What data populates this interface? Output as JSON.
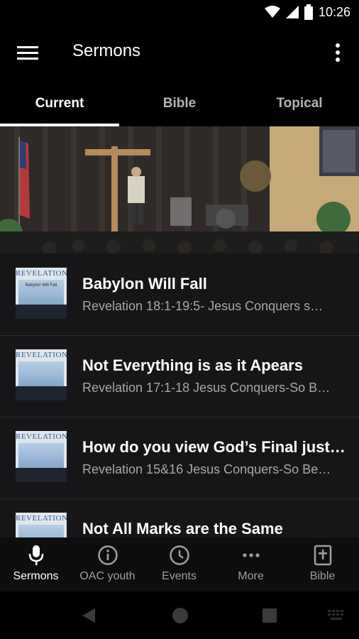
{
  "status": {
    "time": "10:26"
  },
  "app": {
    "title": "Sermons"
  },
  "tabs": [
    {
      "label": "Current",
      "active": true
    },
    {
      "label": "Bible",
      "active": false
    },
    {
      "label": "Topical",
      "active": false
    }
  ],
  "sermons": [
    {
      "title": "Babylon Will Fall",
      "subtitle": "Revelation 18:1-19:5- Jesus Conquers s…",
      "thumb_title": "REVELATION",
      "thumb_subtitle": "Babylon Will Fall"
    },
    {
      "title": "Not Everything is as it Apears",
      "subtitle": "Revelation 17:1-18 Jesus Conquers-So B…",
      "thumb_title": "REVELATION",
      "thumb_subtitle": ""
    },
    {
      "title": "How do you view God’s Final just…",
      "subtitle": "Revelation 15&16 Jesus Conquers-So Be…",
      "thumb_title": "REVELATION",
      "thumb_subtitle": ""
    },
    {
      "title": "Not All Marks are the Same",
      "subtitle": "",
      "thumb_title": "REVELATION",
      "thumb_subtitle": ""
    }
  ],
  "bottom_nav": [
    {
      "label": "Sermons",
      "icon": "mic-icon",
      "active": true
    },
    {
      "label": "OAC youth",
      "icon": "info-icon",
      "active": false
    },
    {
      "label": "Events",
      "icon": "clock-icon",
      "active": false
    },
    {
      "label": "More",
      "icon": "more-horizontal-icon",
      "active": false
    },
    {
      "label": "Bible",
      "icon": "bible-icon",
      "active": false
    }
  ],
  "colors": {
    "background": "#000000",
    "list_bg": "#161618",
    "secondary_text": "#a8a8aa"
  }
}
